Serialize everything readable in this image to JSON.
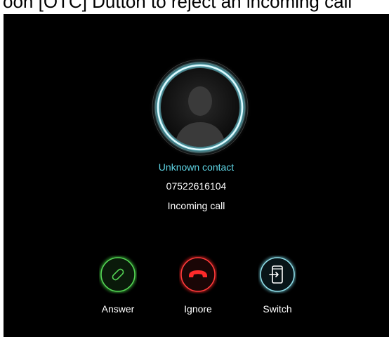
{
  "caption": "oon [OTC] Dutton to reject an incoming call",
  "caller": {
    "name": "Unknown contact",
    "number": "07522616104",
    "status": "Incoming call"
  },
  "actions": {
    "answer": {
      "label": "Answer",
      "icon": "phone-answer-icon",
      "color": "#3ec13e"
    },
    "ignore": {
      "label": "Ignore",
      "icon": "phone-hangup-icon",
      "color": "#e02424"
    },
    "switch": {
      "label": "Switch",
      "icon": "switch-device-icon",
      "color": "#8fdde8"
    }
  },
  "colors": {
    "background": "#000000",
    "accent": "#5fd6e6"
  }
}
